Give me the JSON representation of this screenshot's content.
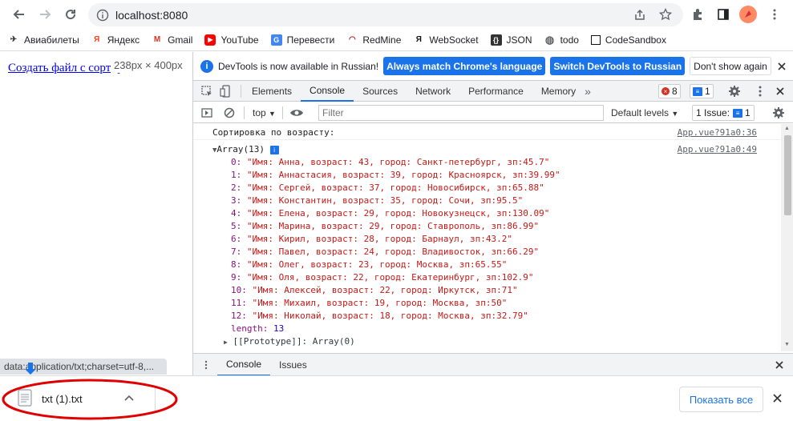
{
  "browser": {
    "url": "localhost:8080",
    "accent": "#1a73e8"
  },
  "bookmarks": [
    {
      "label": "Авиабилеты",
      "icon": "plane-icon"
    },
    {
      "label": "Яндекс",
      "icon": "yandex-icon"
    },
    {
      "label": "Gmail",
      "icon": "gmail-icon"
    },
    {
      "label": "YouTube",
      "icon": "youtube-icon"
    },
    {
      "label": "Перевести",
      "icon": "translate-icon"
    },
    {
      "label": "RedMine",
      "icon": "redmine-icon"
    },
    {
      "label": "WebSocket",
      "icon": "websocket-icon"
    },
    {
      "label": "JSON",
      "icon": "json-icon"
    },
    {
      "label": "todo",
      "icon": "globe-icon"
    },
    {
      "label": "CodeSandbox",
      "icon": "codesandbox-icon"
    }
  ],
  "page": {
    "link": "Создать файл с сортировкой",
    "dimensions": "238px × 400px"
  },
  "devtools": {
    "info_text": "DevTools is now available in Russian!",
    "btn_match": "Always match Chrome's language",
    "btn_switch": "Switch DevTools to Russian",
    "btn_dont_show": "Don't show again",
    "tabs": [
      "Elements",
      "Console",
      "Sources",
      "Network",
      "Performance",
      "Memory"
    ],
    "active_tab": "Console",
    "errors_count": "8",
    "messages_count": "1",
    "context": "top",
    "filter_placeholder": "Filter",
    "levels": "Default levels",
    "issues_label": "1 Issue:",
    "issues_count": "1",
    "drawer_tabs": [
      "Console",
      "Issues"
    ]
  },
  "console": {
    "line1": "Сортировка по возрасту:",
    "line1_src": "App.vue?91a0:36",
    "array_label": "Array(13)",
    "array_src": "App.vue?91a0:49",
    "items": [
      {
        "i": "0:",
        "v": "\"Имя: Анна, возраст: 43, город: Санкт-петербург, зп:45.7\""
      },
      {
        "i": "1:",
        "v": "\"Имя: Аннастасия, возраст: 39, город: Красноярск, зп:39.99\""
      },
      {
        "i": "2:",
        "v": "\"Имя: Сергей, возраст: 37, город: Новосибирск, зп:65.88\""
      },
      {
        "i": "3:",
        "v": "\"Имя: Константин, возраст: 35, город: Сочи, зп:95.5\""
      },
      {
        "i": "4:",
        "v": "\"Имя: Елена, возраст: 29, город: Новокузнецск, зп:130.09\""
      },
      {
        "i": "5:",
        "v": "\"Имя: Марина, возраст: 29, город: Ставрополь, зп:86.99\""
      },
      {
        "i": "6:",
        "v": "\"Имя: Кирил, возраст: 28, город: Барнаул, зп:43.2\""
      },
      {
        "i": "7:",
        "v": "\"Имя: Павел, возраст: 24, город: Владивосток, зп:66.29\""
      },
      {
        "i": "8:",
        "v": "\"Имя: Олег, возраст: 23, город: Москва, зп:65.55\""
      },
      {
        "i": "9:",
        "v": "\"Имя: Оля, возраст: 22, город: Екатеринбург, зп:102.9\""
      },
      {
        "i": "10:",
        "v": "\"Имя: Алексей, возраст: 22, город: Иркутск, зп:71\""
      },
      {
        "i": "11:",
        "v": "\"Имя: Михаил, возраст: 19, город: Москва, зп:50\""
      },
      {
        "i": "12:",
        "v": "\"Имя: Николай, возраст: 18, город: Москва, зп:32.79\""
      }
    ],
    "length_key": "length:",
    "length_val": "13",
    "prototype": "[[Prototype]]: Array(0)"
  },
  "status": {
    "tooltip": "data:application/txt;charset=utf-8,..."
  },
  "download": {
    "filename": "txt (1).txt",
    "show_all": "Показать все"
  }
}
